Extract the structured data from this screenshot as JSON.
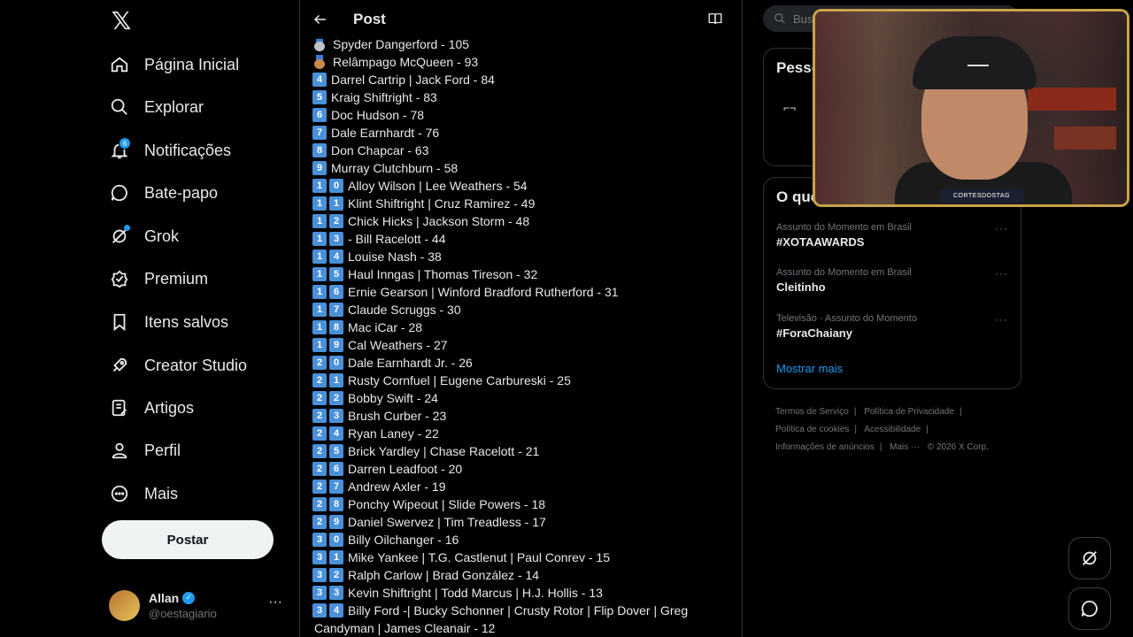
{
  "nav": {
    "items": [
      {
        "label": "Página Inicial",
        "icon": "home-icon"
      },
      {
        "label": "Explorar",
        "icon": "search-icon"
      },
      {
        "label": "Notificações",
        "icon": "bell-icon",
        "badge": "6"
      },
      {
        "label": "Bate-papo",
        "icon": "chat-icon"
      },
      {
        "label": "Grok",
        "icon": "grok-icon"
      },
      {
        "label": "Premium",
        "icon": "premium-icon"
      },
      {
        "label": "Itens salvos",
        "icon": "bookmark-icon"
      },
      {
        "label": "Creator Studio",
        "icon": "rocket-icon"
      },
      {
        "label": "Artigos",
        "icon": "article-icon"
      },
      {
        "label": "Perfil",
        "icon": "person-icon"
      },
      {
        "label": "Mais",
        "icon": "more-circle-icon"
      }
    ],
    "post_button": "Postar"
  },
  "account": {
    "name": "Allan",
    "handle": "@oestagiario",
    "more": "···"
  },
  "header": {
    "title": "Post"
  },
  "post_list": [
    {
      "marker": "medal-silver",
      "text": "Spyder Dangerford - 105"
    },
    {
      "marker": "medal-bronze",
      "text": "Relâmpago McQueen - 93"
    },
    {
      "marker": "4",
      "text": "Darrel Cartrip | Jack Ford - 84"
    },
    {
      "marker": "5",
      "text": "Kraig Shiftright - 83"
    },
    {
      "marker": "6",
      "text": "Doc Hudson - 78"
    },
    {
      "marker": "7",
      "text": "Dale Earnhardt - 76"
    },
    {
      "marker": "8",
      "text": "Don Chapcar - 63"
    },
    {
      "marker": "9",
      "text": "Murray Clutchburn - 58"
    },
    {
      "marker": "10",
      "text": "Alloy Wilson | Lee Weathers - 54"
    },
    {
      "marker": "11",
      "text": "Klint Shiftright | Cruz Ramirez - 49"
    },
    {
      "marker": "12",
      "text": "Chick Hicks | Jackson Storm - 48"
    },
    {
      "marker": "13",
      "text": "- Bill Racelott - 44"
    },
    {
      "marker": "14",
      "text": "Louise Nash - 38"
    },
    {
      "marker": "15",
      "text": "Haul Inngas | Thomas Tireson - 32"
    },
    {
      "marker": "16",
      "text": "Ernie Gearson | Winford Bradford Rutherford - 31"
    },
    {
      "marker": "17",
      "text": "Claude Scruggs - 30"
    },
    {
      "marker": "18",
      "text": "Mac iCar - 28"
    },
    {
      "marker": "19",
      "text": "Cal Weathers - 27"
    },
    {
      "marker": "20",
      "text": "Dale Earnhardt Jr. - 26"
    },
    {
      "marker": "21",
      "text": "Rusty Cornfuel | Eugene Carbureski - 25"
    },
    {
      "marker": "22",
      "text": "Bobby Swift - 24"
    },
    {
      "marker": "23",
      "text": "Brush Curber - 23"
    },
    {
      "marker": "24",
      "text": "Ryan Laney - 22"
    },
    {
      "marker": "25",
      "text": "Brick Yardley | Chase Racelott - 21"
    },
    {
      "marker": "26",
      "text": "Darren Leadfoot - 20"
    },
    {
      "marker": "27",
      "text": "Andrew Axler - 19"
    },
    {
      "marker": "28",
      "text": "Ponchy Wipeout | Slide Powers - 18"
    },
    {
      "marker": "29",
      "text": "Daniel Swervez | Tim Treadless - 17"
    },
    {
      "marker": "30",
      "text": "Billy Oilchanger - 16"
    },
    {
      "marker": "31",
      "text": "Mike Yankee | T.G. Castlenut | Paul Conrev - 15"
    },
    {
      "marker": "32",
      "text": "Ralph Carlow | Brad González - 14"
    },
    {
      "marker": "33",
      "text": "Kevin Shiftright | Todd Marcus | H.J. Hollis - 13"
    },
    {
      "marker": "34",
      "text": "Billy Ford -| Bucky Schonner | Crusty Rotor | Flip Dover | Greg"
    },
    {
      "marker": "",
      "text": "Candyman | James Cleanair - 12"
    }
  ],
  "right": {
    "search_placeholder": "Buscar",
    "people_title": "Pesso",
    "trends_title": "O que",
    "trends": [
      {
        "meta": "Assunto do Momento em Brasil",
        "name": "#XOTAAWARDS"
      },
      {
        "meta": "Assunto do Momento em Brasil",
        "name": "Cleitinho"
      },
      {
        "meta": "Televisão · Assunto do Momento",
        "name": "#ForaChaiany"
      }
    ],
    "show_more": "Mostrar mais",
    "footer": [
      "Termos de Serviço",
      "Política de Privacidade",
      "Política de cookies",
      "Acessibilidade",
      "Informações de anúncios",
      "Mais ···",
      "© 2026 X Corp."
    ]
  },
  "webcam": {
    "tag": "CORTESDOSTAG"
  },
  "colors": {
    "accent": "#1d9bf0",
    "keycap": "#4a90d9",
    "silver": "#c0c4c8",
    "bronze": "#c98a4a"
  }
}
